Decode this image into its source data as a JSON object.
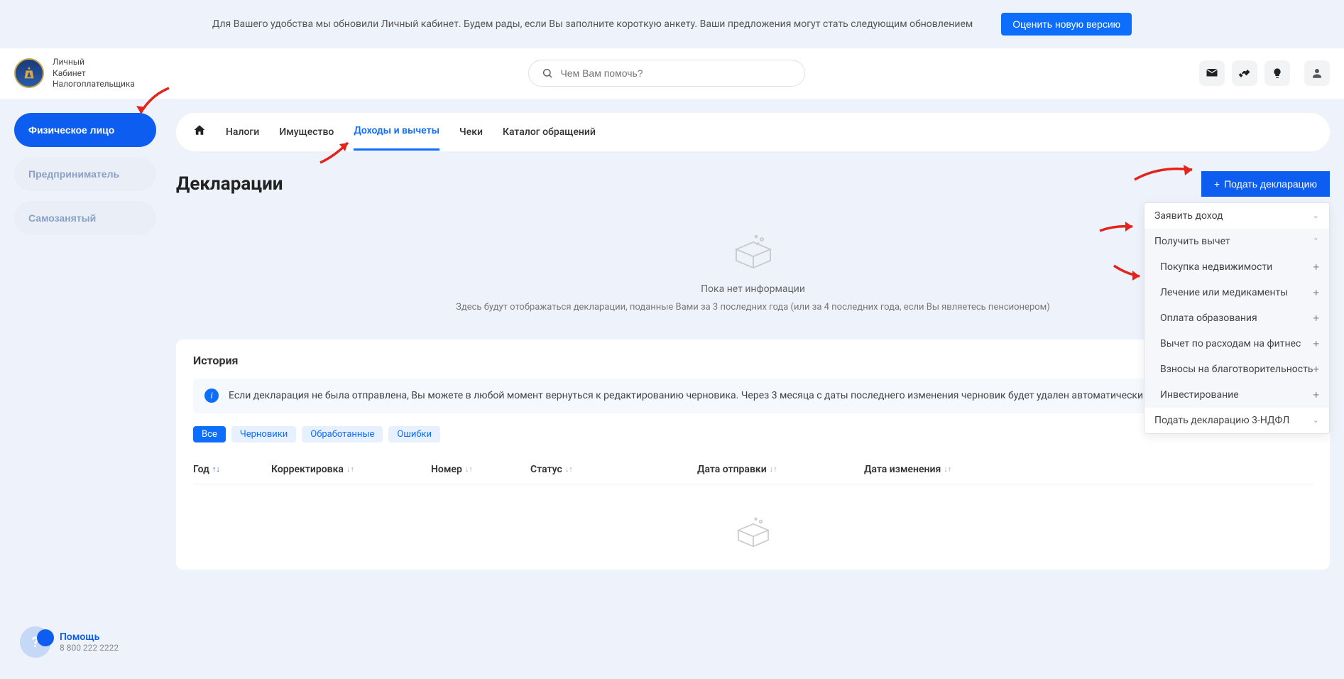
{
  "banner": {
    "text": "Для Вашего удобства мы обновили Личный кабинет. Будем рады, если Вы заполните короткую анкету. Ваши предложения могут стать следующим обновлением",
    "button": "Оценить новую версию"
  },
  "logo": {
    "line1": "Личный",
    "line2": "Кабинет",
    "line3": "Налогоплательщика"
  },
  "search": {
    "placeholder": "Чем Вам помочь?"
  },
  "sidebar": {
    "items": [
      {
        "label": "Физическое лицо",
        "active": true
      },
      {
        "label": "Предприниматель",
        "active": false
      },
      {
        "label": "Самозанятый",
        "active": false
      }
    ]
  },
  "help": {
    "title": "Помощь",
    "phone": "8 800 222 2222"
  },
  "nav": {
    "items": [
      "Налоги",
      "Имущество",
      "Доходы и вычеты",
      "Чеки",
      "Каталог обращений"
    ],
    "active_index": 2
  },
  "page": {
    "title": "Декларации",
    "submit": "Подать декларацию"
  },
  "dropdown": {
    "item1": "Заявить доход",
    "item2": "Получить вычет",
    "subs": [
      "Покупка недвижимости",
      "Лечение или медикаменты",
      "Оплата образования",
      "Вычет по расходам на фитнес",
      "Взносы на благотворительность",
      "Инвестирование"
    ],
    "item3": "Подать декларацию 3-НДФЛ"
  },
  "empty": {
    "title": "Пока нет информации",
    "sub": "Здесь будут отображаться декларации, поданные Вами за 3 последних года (или за 4 последних года, если Вы являетесь пенсионером)"
  },
  "history": {
    "title": "История",
    "info": "Если декларация не была отправлена, Вы можете в любой момент вернуться к редактированию черновика. Через 3 месяца с даты последнего изменения черновик будет удален автоматически",
    "filters": [
      "Все",
      "Черновики",
      "Обработанные",
      "Ошибки"
    ],
    "columns": [
      "Год",
      "Корректировка",
      "Номер",
      "Статус",
      "Дата отправки",
      "Дата изменения"
    ]
  }
}
